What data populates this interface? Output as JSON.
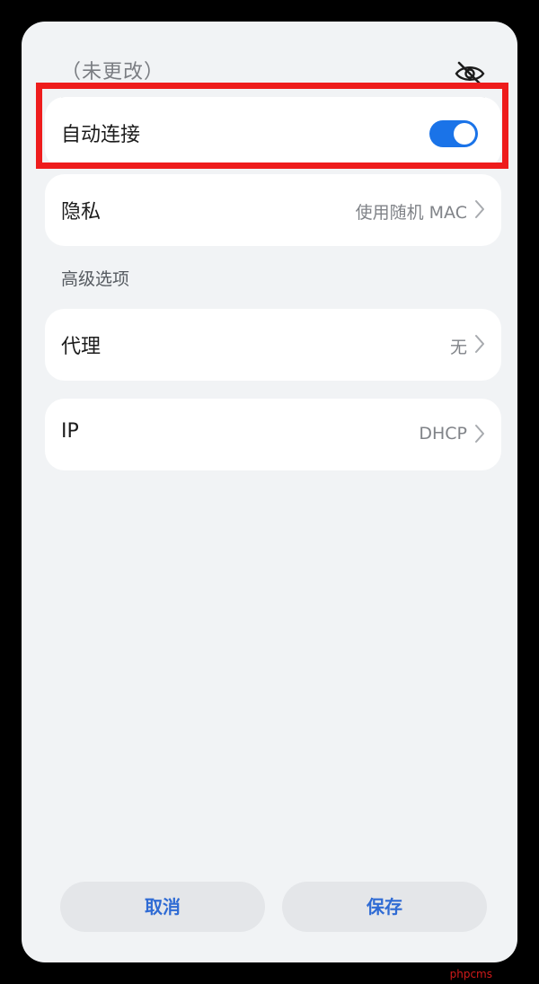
{
  "password": {
    "value": "（未更改）",
    "visibility_icon": "eye-off-icon"
  },
  "auto_connect": {
    "label": "自动连接",
    "enabled": true,
    "toggle_color": "#1a73e8"
  },
  "privacy": {
    "label": "隐私",
    "value": "使用随机 MAC"
  },
  "advanced": {
    "header": "高级选项",
    "proxy": {
      "label": "代理",
      "value": "无"
    },
    "ip": {
      "label": "IP",
      "value": "DHCP"
    }
  },
  "actions": {
    "cancel_label": "取消",
    "save_label": "保存",
    "accent_color": "#2f6bd4"
  },
  "highlight_color": "#ee1c1c",
  "watermark": "phpcms"
}
